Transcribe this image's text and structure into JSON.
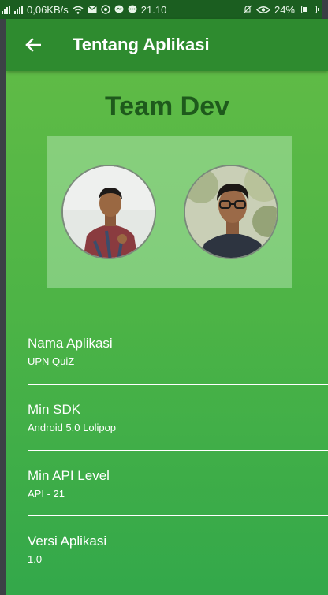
{
  "status_bar": {
    "speed": "0,06KB/s",
    "time": "21.10",
    "battery": "24%",
    "icons": [
      "signal-icon",
      "signal-icon",
      "wifi-icon",
      "gmail-icon",
      "whatsapp-icon",
      "messenger-icon",
      "chat-icon",
      "mute-icon",
      "eye-icon",
      "battery-icon"
    ]
  },
  "app_bar": {
    "title": "Tentang Aplikasi",
    "back_icon": "arrow-left-icon"
  },
  "team": {
    "title": "Team Dev",
    "members": [
      {
        "photo": "avatar-developer-1"
      },
      {
        "photo": "avatar-developer-2"
      }
    ]
  },
  "info": [
    {
      "label": "Nama Aplikasi",
      "value": "UPN QuiZ"
    },
    {
      "label": "Min SDK",
      "value": "Android 5.0 Lolipop"
    },
    {
      "label": "Min API Level",
      "value": "API - 21"
    },
    {
      "label": "Versi Aplikasi",
      "value": "1.0"
    }
  ],
  "colors": {
    "status_bar": "#1b5e20",
    "app_bar": "#2e8b2f",
    "content_top": "#5fbb46",
    "content_bottom": "#33a84a",
    "team_title": "#1e5a1c"
  }
}
